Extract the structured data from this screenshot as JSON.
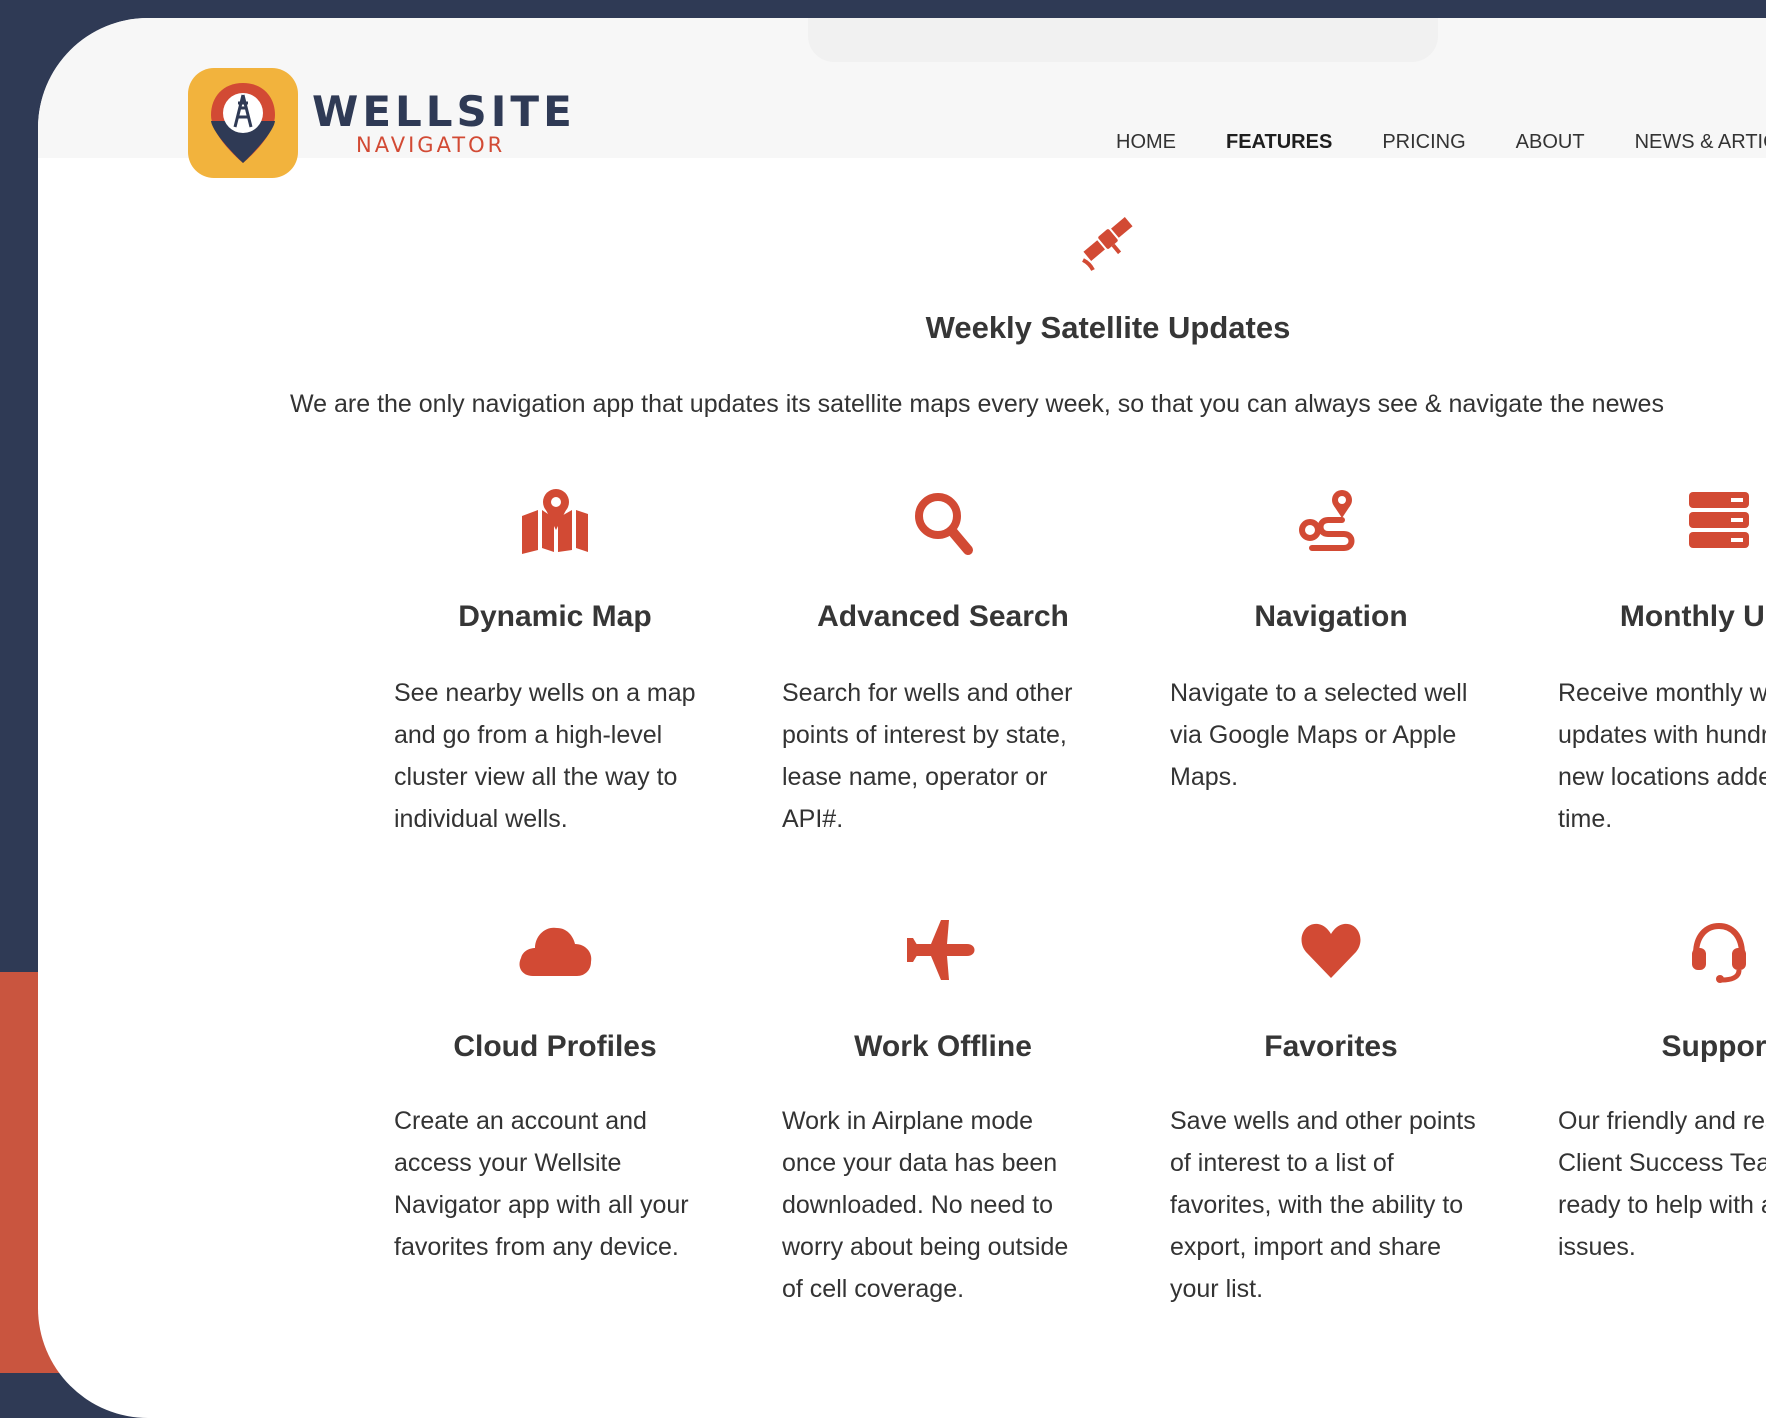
{
  "colors": {
    "brand_red": "#d24a34",
    "navy": "#2f3a55",
    "gold": "#f2b33d"
  },
  "logo": {
    "title": "WELLSITE",
    "subtitle": "NAVIGATOR"
  },
  "nav": [
    {
      "label": "HOME",
      "active": false
    },
    {
      "label": "FEATURES",
      "active": true
    },
    {
      "label": "PRICING",
      "active": false
    },
    {
      "label": "ABOUT",
      "active": false
    },
    {
      "label": "NEWS & ARTICL",
      "active": false
    }
  ],
  "hero": {
    "icon": "satellite-icon",
    "title": "Weekly Satellite Updates",
    "description": "We are the only navigation app that updates its satellite maps every week, so that you can always see & navigate the newes"
  },
  "features": [
    {
      "icon": "map-pin-icon",
      "title": "Dynamic Map",
      "lines": "See nearby wells on a map\nand go from a high-level\ncluster view all the way to\nindividual wells."
    },
    {
      "icon": "search-icon",
      "title": "Advanced Search",
      "lines": "Search for wells and other\npoints of interest by state,\nlease name, operator or\nAPI#."
    },
    {
      "icon": "route-icon",
      "title": "Navigation",
      "lines": "Navigate to a selected well\nvia Google Maps or Apple\nMaps."
    },
    {
      "icon": "server-icon",
      "title": "Monthly Upda",
      "lines": "Receive monthly we\nupdates with hundre\nnew locations addec\ntime."
    },
    {
      "icon": "cloud-icon",
      "title": "Cloud Profiles",
      "lines": "Create an account and\naccess your Wellsite\nNavigator app with all your\nfavorites from any device."
    },
    {
      "icon": "airplane-icon",
      "title": "Work Offline",
      "lines": "Work in Airplane mode\nonce your data has been\ndownloaded. No need to\nworry about being outside\nof cell coverage."
    },
    {
      "icon": "heart-icon",
      "title": "Favorites",
      "lines": "Save wells and other points\nof interest to a list of\nfavorites, with the ability to\nexport, import and share\nyour list."
    },
    {
      "icon": "headset-icon",
      "title": "Support",
      "lines": "Our friendly and res\nClient Success Team\nready to help with a\nissues."
    }
  ]
}
